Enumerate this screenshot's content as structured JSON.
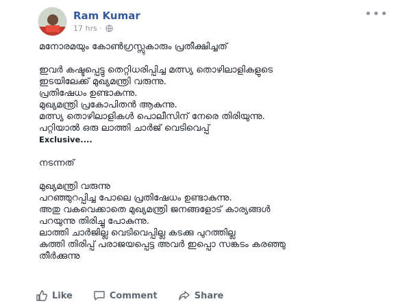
{
  "post": {
    "author": "Ram Kumar",
    "time": "17 hrs",
    "separator": "·",
    "more_menu": "•••",
    "lines": [
      "മനോരമയും കോൺഗ്രസ്സുകാരും പ്രതീക്ഷിച്ചത്",
      "ഇവർ കഷ്ടപ്പെട്ടു തെറ്റിധരിപ്പിച്ച മത്സ്യ തൊഴിലാളികളുടെ",
      "ഇടയിലേക്ക് മുഖ്യമന്ത്രി വരുന്നു.",
      "പ്രതിഷേധം ഉണ്ടാകുന്നു.",
      "മുഖ്യമന്ത്രി പ്രകോപിതൻ ആകുന്നു.",
      "മത്സ്യ തൊഴിലാളികൾ പൊലീസിന് നേരെ തിരിയുന്നു.",
      "പറ്റിയാൽ ഒരു ലാത്തി ചാർജ് വെടിവെപ്പ്",
      "Exclusive....",
      "",
      "നടന്നത്",
      "",
      "മുഖ്യമന്ത്രി വരുന്നു",
      "പറഞ്ഞുറപ്പിച്ച പോലെ പ്രതിഷേധം ഉണ്ടാകുന്നു.",
      "അതു വകവെക്കാതെ മുഖ്യമന്ത്രി ജനങ്ങളോട് കാര്യങ്ങൾ",
      "പറയുന്നു തിരിച്ചു പോകുന്നു.",
      "ലാത്തി ചാർജില്ല വെടിവെപ്പില്ല കടക്കു പുറത്തില്ല",
      "കുത്തി തിരിപ്പ് പരാജയപ്പെട്ട അവർ ഇപ്പൊ സങ്കടം കരഞ്ഞു",
      "തീർക്കുന്നു"
    ]
  },
  "actions": {
    "like": "Like",
    "comment": "Comment",
    "share": "Share"
  },
  "colors": {
    "author": "#365899",
    "meta": "#90949c",
    "action": "#606770"
  },
  "icons": [
    "globe-icon",
    "more-menu-icon",
    "like-icon",
    "comment-icon",
    "share-icon"
  ]
}
